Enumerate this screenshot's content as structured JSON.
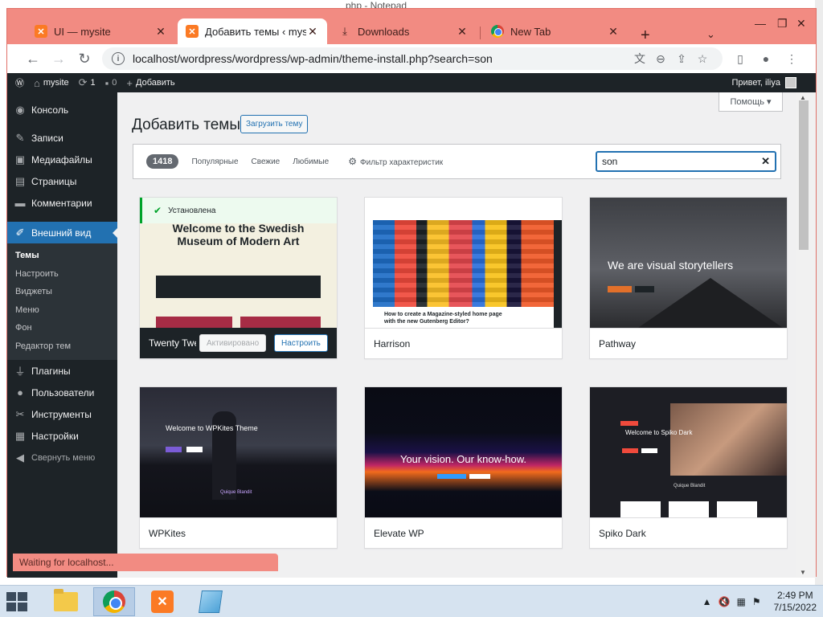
{
  "background": {
    "title": "php - Notepad"
  },
  "browser": {
    "tabs": [
      {
        "label": "UI — mysite",
        "icon": "xampp-icon"
      },
      {
        "label": "Добавить темы ‹ mysite",
        "icon": "xampp-icon"
      },
      {
        "label": "Downloads",
        "icon": "download-icon"
      },
      {
        "label": "New Tab",
        "icon": "chrome-icon"
      }
    ],
    "url": "localhost/wordpress/wordpress/wp-admin/theme-install.php?search=son"
  },
  "adminbar": {
    "site": "mysite",
    "updates": "1",
    "comments": "0",
    "add_new": "Добавить",
    "greeting": "Привет, iliya"
  },
  "sidebar": {
    "items": [
      {
        "label": "Консоль",
        "icon": "dashboard-icon"
      },
      {
        "label": "Записи",
        "icon": "pin-icon"
      },
      {
        "label": "Медиафайлы",
        "icon": "media-icon"
      },
      {
        "label": "Страницы",
        "icon": "page-icon"
      },
      {
        "label": "Комментарии",
        "icon": "comment-icon"
      },
      {
        "label": "Внешний вид",
        "icon": "brush-icon"
      },
      {
        "label": "Плагины",
        "icon": "plugin-icon"
      },
      {
        "label": "Пользователи",
        "icon": "users-icon"
      },
      {
        "label": "Инструменты",
        "icon": "wrench-icon"
      },
      {
        "label": "Настройки",
        "icon": "settings-icon"
      },
      {
        "label": "Свернуть меню",
        "icon": "collapse-icon"
      }
    ],
    "submenu": [
      "Темы",
      "Настроить",
      "Виджеты",
      "Меню",
      "Фон",
      "Редактор тем"
    ]
  },
  "main": {
    "help": "Помощь",
    "title": "Добавить темы",
    "upload": "Загрузить тему",
    "filter": {
      "count": "1418",
      "popular": "Популярные",
      "latest": "Свежие",
      "favorites": "Любимые",
      "feature_filter": "Фильтр характеристик",
      "search_value": "son"
    },
    "themes": [
      {
        "name": "Twenty Twenty-Two",
        "installed_label": "Установлена",
        "shot_title": "Welcome to the Swedish Museum of Modern Art",
        "activated_label": "Активировано",
        "customize_label": "Настроить"
      },
      {
        "name": "Harrison",
        "shot_caption": "How to create a Magazine-styled home page with the new Gutenberg Editor?"
      },
      {
        "name": "Pathway",
        "shot_heading": "We are visual storytellers"
      },
      {
        "name": "WPKites",
        "shot_heading": "Welcome to WPKites Theme",
        "shot_sub": "Quique Blandit"
      },
      {
        "name": "Elevate WP",
        "shot_heading": "Your vision. Our know-how."
      },
      {
        "name": "Spiko Dark",
        "shot_heading": "Welcome to Spiko Dark",
        "shot_sub": "Quique Blandit"
      }
    ]
  },
  "status": "Waiting for localhost...",
  "taskbar": {
    "time": "2:49 PM",
    "date": "7/15/2022"
  }
}
